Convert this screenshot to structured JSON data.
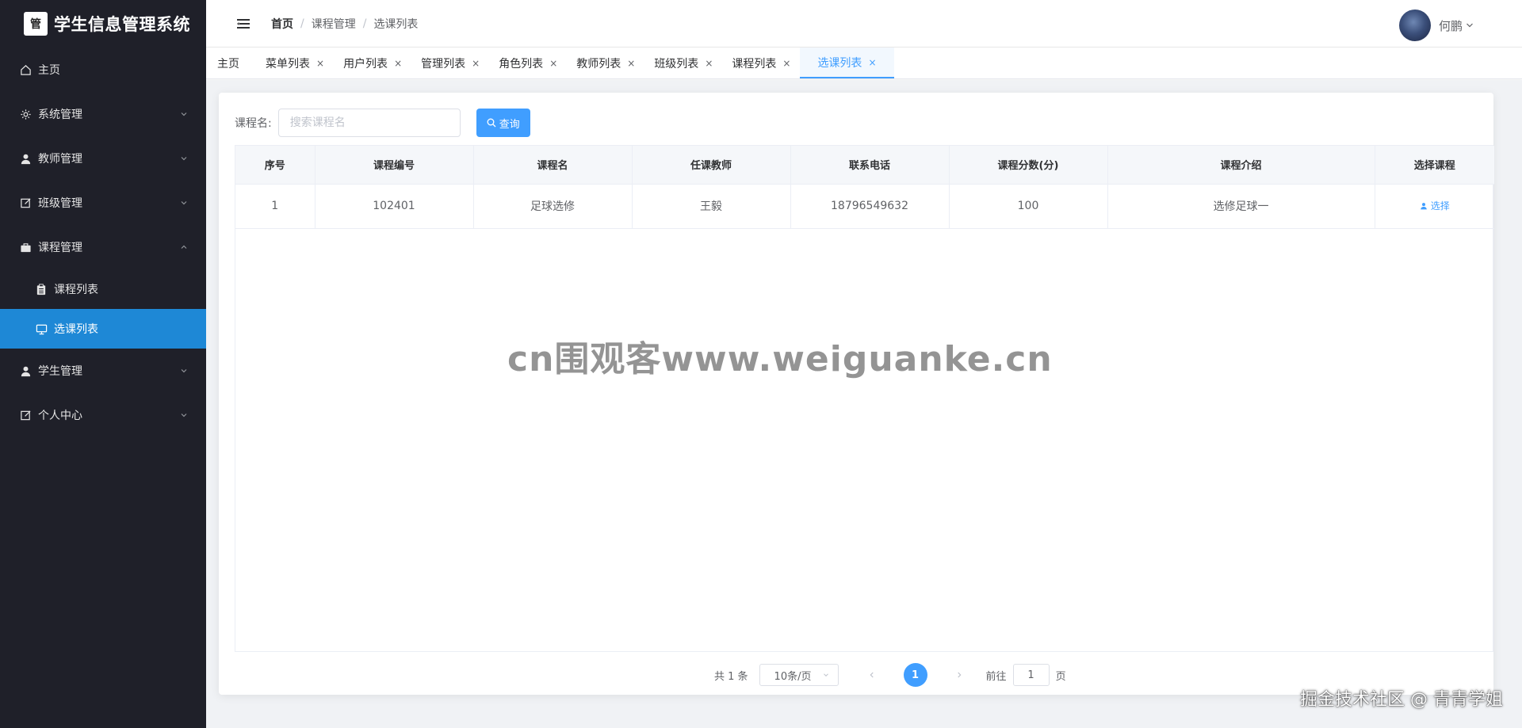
{
  "app": {
    "title": "学生信息管理系统",
    "logo_glyph": "管"
  },
  "sidebar": {
    "items": [
      {
        "label": "主页",
        "icon": "home-icon"
      },
      {
        "label": "系统管理",
        "icon": "gear-icon"
      },
      {
        "label": "教师管理",
        "icon": "user-icon"
      },
      {
        "label": "班级管理",
        "icon": "edit-icon"
      },
      {
        "label": "课程管理",
        "icon": "briefcase-icon",
        "expanded": true
      },
      {
        "label": "学生管理",
        "icon": "user-icon"
      },
      {
        "label": "个人中心",
        "icon": "edit-icon"
      }
    ],
    "sub_items": [
      {
        "label": "课程列表",
        "icon": "clipboard-icon"
      },
      {
        "label": "选课列表",
        "icon": "monitor-icon",
        "active": true
      }
    ]
  },
  "header": {
    "breadcrumb": [
      "首页",
      "课程管理",
      "选课列表"
    ],
    "username": "何鹏"
  },
  "tabs": [
    {
      "label": "主页",
      "closable": false
    },
    {
      "label": "菜单列表",
      "closable": true
    },
    {
      "label": "用户列表",
      "closable": true
    },
    {
      "label": "管理列表",
      "closable": true
    },
    {
      "label": "角色列表",
      "closable": true
    },
    {
      "label": "教师列表",
      "closable": true
    },
    {
      "label": "班级列表",
      "closable": true
    },
    {
      "label": "课程列表",
      "closable": true
    },
    {
      "label": "选课列表",
      "closable": true,
      "active": true
    }
  ],
  "close_glyph": "×",
  "search": {
    "label": "课程名:",
    "placeholder": "搜索课程名",
    "button_label": "查询"
  },
  "table": {
    "columns": [
      "序号",
      "课程编号",
      "课程名",
      "任课教师",
      "联系电话",
      "课程分数(分)",
      "课程介绍",
      "选择课程"
    ],
    "rows": [
      [
        "1",
        "102401",
        "足球选修",
        "王毅",
        "18796549632",
        "100",
        "选修足球一",
        "选择"
      ]
    ]
  },
  "pagination": {
    "total": "共 1 条",
    "page_size": "10条/页",
    "current_page": "1",
    "goto_prefix": "前往",
    "goto_value": "1",
    "goto_suffix": "页"
  },
  "overlays": {
    "watermark": "cn围观客www.weiguanke.cn",
    "footer": "掘金技术社区 @ 青青学姐"
  },
  "colors": {
    "sidebar_bg": "#1f2029",
    "active_menu": "#1e88d6",
    "primary": "#409eff"
  }
}
